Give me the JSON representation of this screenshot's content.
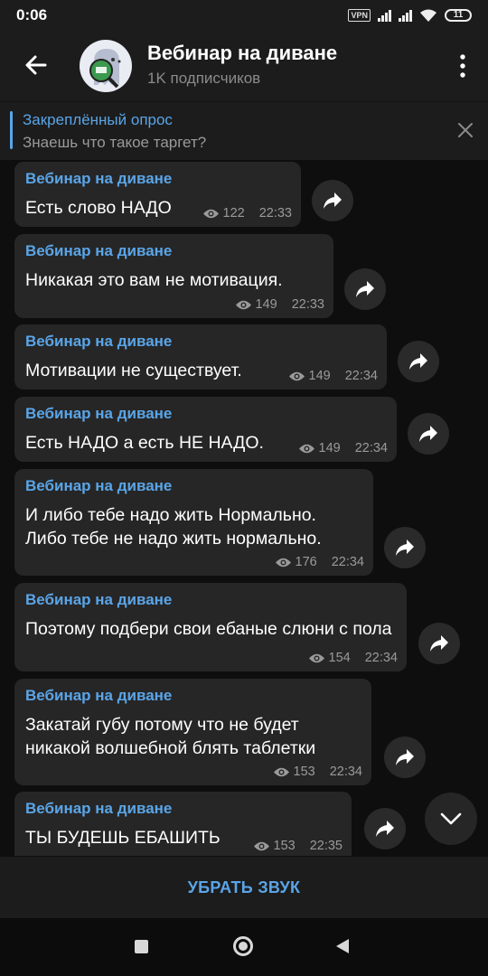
{
  "status_bar": {
    "time": "0:06",
    "vpn": "VPN",
    "battery": "11"
  },
  "header": {
    "title": "Вебинар на диване",
    "subtitle": "1K подписчиков"
  },
  "pinned": {
    "title": "Закреплённый опрос",
    "text": "Знаешь что такое таргет?"
  },
  "messages": [
    {
      "author": "Вебинар на диване",
      "text": "Есть слово НАДО",
      "views": "122",
      "time": "22:33"
    },
    {
      "author": "Вебинар на диване",
      "text": "Никакая это вам не мотивация.",
      "views": "149",
      "time": "22:33"
    },
    {
      "author": "Вебинар на диване",
      "text": "Мотивации не существует.",
      "views": "149",
      "time": "22:34"
    },
    {
      "author": "Вебинар на диване",
      "text": "Есть НАДО а есть НЕ НАДО.",
      "views": "149",
      "time": "22:34"
    },
    {
      "author": "Вебинар на диване",
      "text": "И либо тебе надо жить Нормально. Либо тебе не надо жить нормально.",
      "views": "176",
      "time": "22:34"
    },
    {
      "author": "Вебинар на диване",
      "text": "Поэтому подбери свои ебаные слюни с пола",
      "views": "154",
      "time": "22:34"
    },
    {
      "author": "Вебинар на диване",
      "text": "Закатай губу потому что не будет никакой волшебной блять таблетки",
      "views": "153",
      "time": "22:34"
    },
    {
      "author": "Вебинар на диване",
      "text": "ТЫ БУДЕШЬ ЕБАШИТЬ",
      "views": "153",
      "time": "22:35"
    }
  ],
  "bottom": {
    "mute_label": "УБРАТЬ ЗВУК"
  },
  "colors": {
    "accent": "#5aa5e8",
    "bubble": "#262626",
    "background": "#0e0e0e",
    "bar": "#1c1c1c"
  }
}
